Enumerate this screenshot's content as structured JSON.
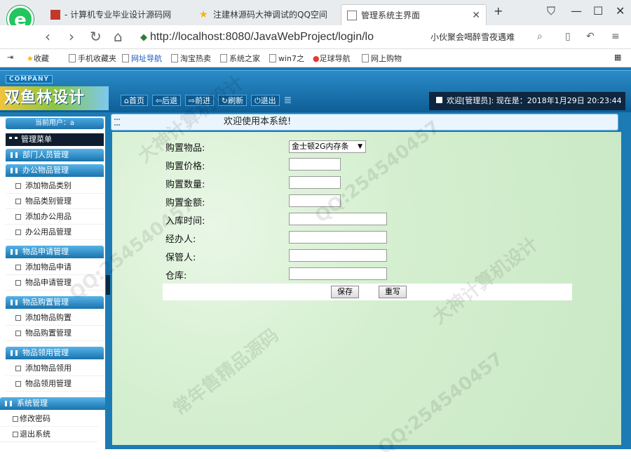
{
  "browser": {
    "tabs": [
      {
        "title": "- 计算机专业毕业设计源码网"
      },
      {
        "title": "注建林源码大神调试的QQ空间"
      },
      {
        "title": "管理系统主界面"
      }
    ],
    "url": "http://localhost:8080/JavaWebProject/login/lo",
    "search_hint": "小伙聚会喝醉雪夜遇难",
    "bookmarks": [
      "收藏",
      "手机收藏夹",
      "网址导航",
      "淘宝热卖",
      "系统之家",
      "win7之",
      "足球导航",
      "网上购物"
    ]
  },
  "app": {
    "company_label": "COMPANY",
    "brand": "双鱼林设计",
    "nav": [
      "首页",
      "后退",
      "前进",
      "刷新",
      "退出"
    ],
    "status": "欢迎[管理员]:  现在是：2018年1月29日 20:23:44",
    "current_user_label": "当前用户：a",
    "menu_title": "管理菜单",
    "welcome": "欢迎使用本系统!"
  },
  "sidebar": {
    "sections": [
      {
        "label": "部门人员管理",
        "items": []
      },
      {
        "label": "办公物品管理",
        "items": [
          "添加物品类别",
          "物品类别管理",
          "添加办公用品",
          "办公用品管理"
        ]
      },
      {
        "label": "物品申请管理",
        "items": [
          "添加物品申请",
          "物品申请管理"
        ]
      },
      {
        "label": "物品购置管理",
        "items": [
          "添加物品购置",
          "物品购置管理"
        ]
      },
      {
        "label": "物品领用管理",
        "items": [
          "添加物品领用",
          "物品领用管理"
        ]
      },
      {
        "label": "系统管理",
        "items": [
          "修改密码",
          "退出系统"
        ]
      }
    ]
  },
  "form": {
    "fields": [
      {
        "label": "购置物品:",
        "value": "金士顿2G内存条"
      },
      {
        "label": "购置价格:",
        "value": ""
      },
      {
        "label": "购置数量:",
        "value": ""
      },
      {
        "label": "购置金额:",
        "value": ""
      },
      {
        "label": "入库时间:",
        "value": ""
      },
      {
        "label": "经办人:",
        "value": ""
      },
      {
        "label": "保管人:",
        "value": ""
      },
      {
        "label": "仓库:",
        "value": ""
      }
    ],
    "save_label": "保存",
    "reset_label": "重写"
  },
  "watermarks": [
    "大神计算机设计",
    "QQ:254540457",
    "常年售精品源码"
  ]
}
